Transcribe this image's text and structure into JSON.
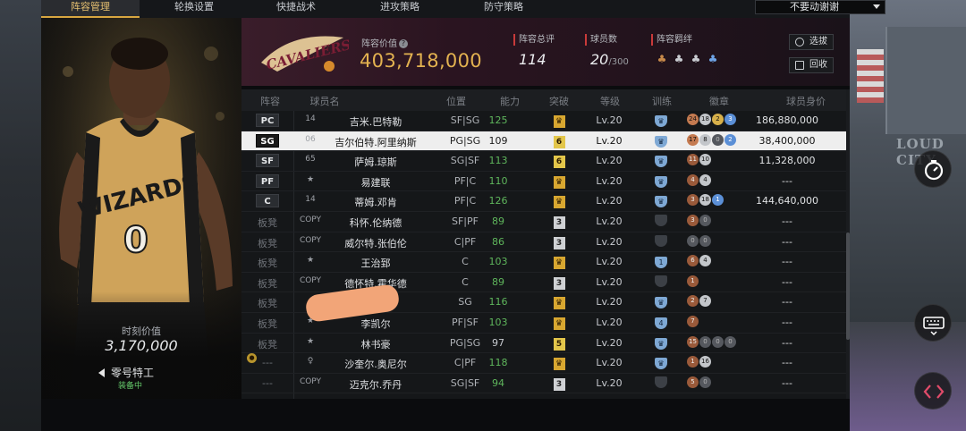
{
  "nav": {
    "tabs": [
      "阵容管理",
      "轮换设置",
      "快捷战术",
      "进攻策略",
      "防守策略"
    ],
    "active_tab": 0,
    "dropdown_value": "不要动谢谢"
  },
  "player_card": {
    "time_value_label": "时刻价值",
    "time_value": "3,170,000",
    "name": "零号特工",
    "status": "装备中",
    "jersey_team_text": "WIZARDS",
    "jersey_number": "0"
  },
  "team_banner": {
    "logo_text": "CAVALIERS",
    "value_label": "阵容价值",
    "value": "403,718,000",
    "rating_label": "阵容总评",
    "rating": "114",
    "count_label": "球员数",
    "count": "20",
    "count_max": "/300",
    "chem_label": "阵容羁绊",
    "chem_icons": [
      "people-bronze-icon",
      "people-silver-icon",
      "people-silver-icon",
      "people-blue-icon"
    ],
    "select_button": "选拔",
    "recycle_button": "回收"
  },
  "table": {
    "headers": [
      "阵容",
      "球员名",
      "位置",
      "能力",
      "突破",
      "等级",
      "训练",
      "徽章",
      "球员身价"
    ],
    "rows": [
      {
        "pos": "PC",
        "num": "14",
        "name": "吉米.巴特勒",
        "position": "SF|SG",
        "ability": "125",
        "break": "crown",
        "level": "Lv.20",
        "train": "shield",
        "badges": [
          [
            "b",
            "24"
          ],
          [
            "s",
            "18"
          ],
          [
            "g",
            "2"
          ],
          [
            "bl",
            "3"
          ]
        ],
        "salary": "186,880,000",
        "starter": true
      },
      {
        "pos": "SG",
        "num": "06",
        "name": "吉尔伯特.阿里纳斯",
        "position": "PG|SG",
        "ability": "109",
        "break": "6",
        "level": "Lv.20",
        "train": "shield",
        "badges": [
          [
            "b",
            "17"
          ],
          [
            "s",
            "8"
          ],
          [
            "d",
            "0"
          ],
          [
            "bl",
            "2"
          ]
        ],
        "salary": "38,400,000",
        "starter": true,
        "selected": true
      },
      {
        "pos": "SF",
        "num": "65",
        "name": "萨姆.琼斯",
        "position": "SG|SF",
        "ability": "113",
        "break": "6",
        "level": "Lv.20",
        "train": "shield",
        "badges": [
          [
            "br",
            "11"
          ],
          [
            "s",
            "10"
          ]
        ],
        "salary": "11,328,000",
        "starter": true
      },
      {
        "pos": "PF",
        "num": "★",
        "name": "易建联",
        "position": "PF|C",
        "ability": "110",
        "break": "crown",
        "level": "Lv.20",
        "train": "shield",
        "badges": [
          [
            "br",
            "4"
          ],
          [
            "s",
            "4"
          ]
        ],
        "salary": "---",
        "starter": true
      },
      {
        "pos": "C",
        "num": "14",
        "name": "蒂姆.邓肯",
        "position": "PF|C",
        "ability": "126",
        "break": "crown",
        "level": "Lv.20",
        "train": "shield",
        "badges": [
          [
            "br",
            "3"
          ],
          [
            "s",
            "18"
          ],
          [
            "bl",
            "1"
          ]
        ],
        "salary": "144,640,000",
        "starter": true
      },
      {
        "pos": "板凳",
        "num": "COPY",
        "name": "科怀.伦纳德",
        "position": "SF|PF",
        "ability": "89",
        "break": "3",
        "level": "Lv.20",
        "train": "dim",
        "badges": [
          [
            "br",
            "3"
          ],
          [
            "d",
            "0"
          ]
        ],
        "salary": "---"
      },
      {
        "pos": "板凳",
        "num": "COPY",
        "name": "威尔特.张伯伦",
        "position": "C|PF",
        "ability": "86",
        "break": "3",
        "level": "Lv.20",
        "train": "dim",
        "badges": [
          [
            "d",
            "0"
          ],
          [
            "d",
            "0"
          ]
        ],
        "salary": "---"
      },
      {
        "pos": "板凳",
        "num": "★",
        "name": "王治郅",
        "position": "C",
        "ability": "103",
        "break": "crown",
        "level": "Lv.20",
        "train": "shield1",
        "badges": [
          [
            "br",
            "6"
          ],
          [
            "s",
            "4"
          ]
        ],
        "salary": "---"
      },
      {
        "pos": "板凳",
        "num": "COPY",
        "name": "德怀特.霍华德",
        "position": "C",
        "ability": "89",
        "break": "3",
        "level": "Lv.20",
        "train": "dim",
        "badges": [
          [
            "br",
            "1"
          ]
        ],
        "salary": "---"
      },
      {
        "pos": "板凳",
        "num": "",
        "name": "",
        "position": "SG",
        "ability": "116",
        "break": "crown",
        "level": "Lv.20",
        "train": "shield",
        "badges": [
          [
            "br",
            "2"
          ],
          [
            "s",
            "7"
          ]
        ],
        "salary": "---"
      },
      {
        "pos": "板凳",
        "num": "★",
        "name": "李凯尔",
        "position": "PF|SF",
        "ability": "103",
        "break": "crown",
        "level": "Lv.20",
        "train": "shield4",
        "badges": [
          [
            "br",
            "7"
          ]
        ],
        "salary": "---"
      },
      {
        "pos": "板凳",
        "num": "★",
        "name": "林书豪",
        "position": "PG|SG",
        "ability": "97",
        "break": "5",
        "level": "Lv.20",
        "train": "shield",
        "badges": [
          [
            "br",
            "15"
          ],
          [
            "d",
            "0"
          ],
          [
            "d",
            "0"
          ],
          [
            "d",
            "0"
          ]
        ],
        "salary": "---"
      },
      {
        "pos": "---",
        "num": "♀",
        "name": "沙奎尔.奥尼尔",
        "position": "C|PF",
        "ability": "118",
        "break": "crown",
        "level": "Lv.20",
        "train": "shield",
        "badges": [
          [
            "br",
            "1"
          ],
          [
            "s",
            "16"
          ]
        ],
        "salary": "---",
        "special": true
      },
      {
        "pos": "---",
        "num": "COPY",
        "name": "迈克尔.乔丹",
        "position": "SG|SF",
        "ability": "94",
        "break": "3",
        "level": "Lv.20",
        "train": "dim",
        "badges": [
          [
            "br",
            "5"
          ],
          [
            "d",
            "0"
          ]
        ],
        "salary": "---"
      }
    ]
  },
  "side_buttons": [
    "timer-icon",
    "keyboard-icon",
    "code-toggle-icon"
  ],
  "background_text": "LOUD CITY"
}
